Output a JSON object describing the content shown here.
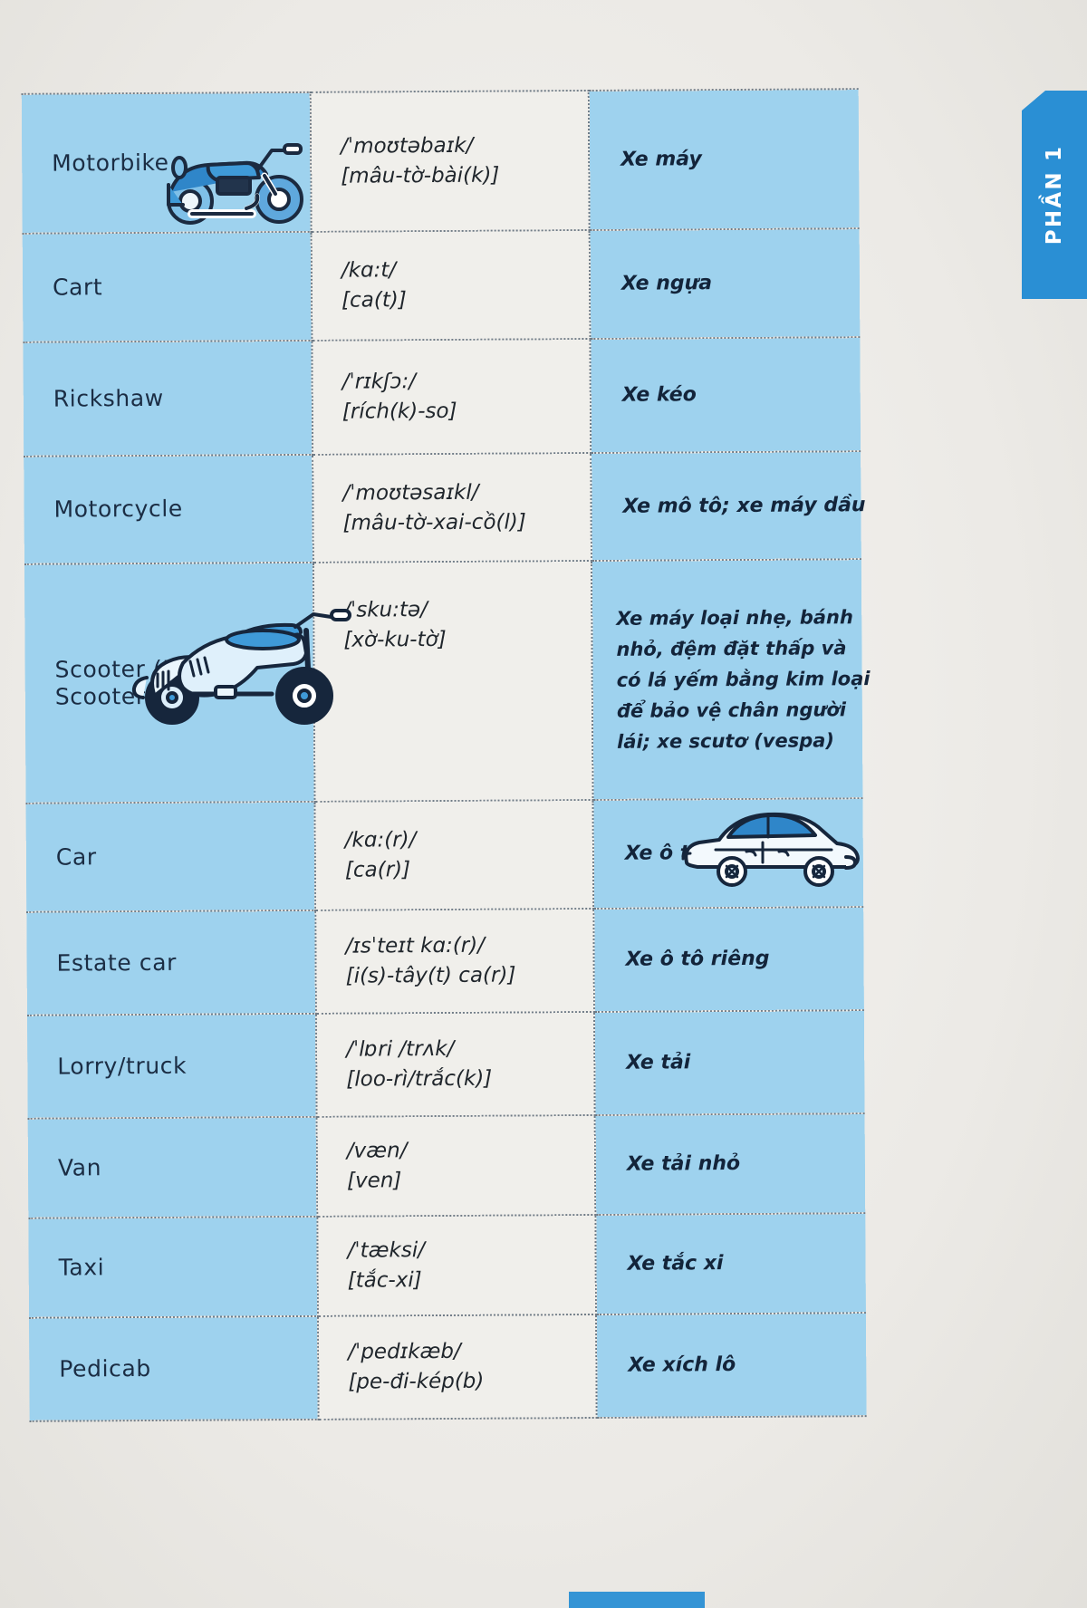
{
  "page": {
    "side_tab_label": "PHẦN 1",
    "accent_color": "#2a8fd4",
    "row_blue": "#9ed2ee",
    "row_cream": "#f0efeb"
  },
  "table": {
    "rows": [
      {
        "english": "Motorbike",
        "ipa": "/ˈmoʊtəbaɪk/",
        "viet_phonetic": "[mâu-tờ-bài(k)]",
        "meaning_lines": [
          "Xe máy"
        ],
        "illustration": "motorbike-illustration"
      },
      {
        "english": "Cart",
        "ipa": "/kɑ:t/",
        "viet_phonetic": "[ca(t)]",
        "meaning_lines": [
          "Xe ngựa"
        ],
        "illustration": null
      },
      {
        "english": "Rickshaw",
        "ipa": "/ˈrɪkʃɔ:/",
        "viet_phonetic": "[rích(k)-so]",
        "meaning_lines": [
          "Xe kéo"
        ],
        "illustration": null
      },
      {
        "english": "Motorcycle",
        "ipa": "/ˈmoʊtəsaɪkl/",
        "viet_phonetic": "[mâu-tờ-xai-cồ(l)]",
        "meaning_lines": [
          "Xe mô tô; xe máy dầu"
        ],
        "illustration": null
      },
      {
        "english": "Scooter (Motor Scooter)",
        "ipa": "/ˈsku:tə/",
        "viet_phonetic": "[xờ-ku-tờ]",
        "meaning_lines": [
          "Xe máy loại nhẹ, bánh",
          "nhỏ, đệm đặt thấp và",
          "có lá yếm bằng kim loại",
          "để bảo vệ chân người",
          "lái; xe scutơ (vespa)"
        ],
        "illustration": "scooter-illustration"
      },
      {
        "english": "Car",
        "ipa": "/kɑ:(r)/",
        "viet_phonetic": "[ca(r)]",
        "meaning_lines": [
          "Xe ô tô"
        ],
        "illustration": "car-illustration"
      },
      {
        "english": "Estate car",
        "ipa": "/ɪsˈteɪt kɑ:(r)/",
        "viet_phonetic": "[i(s)-tây(t) ca(r)]",
        "meaning_lines": [
          "Xe ô tô riêng"
        ],
        "illustration": null
      },
      {
        "english": "Lorry/truck",
        "ipa": "/ˈlɒri /trʌk/",
        "viet_phonetic": "[loo-rì/trắc(k)]",
        "meaning_lines": [
          "Xe tải"
        ],
        "illustration": null
      },
      {
        "english": "Van",
        "ipa": "/væn/",
        "viet_phonetic": "[ven]",
        "meaning_lines": [
          "Xe tải nhỏ"
        ],
        "illustration": null
      },
      {
        "english": "Taxi",
        "ipa": "/ˈtæksi/",
        "viet_phonetic": "[tắc-xi]",
        "meaning_lines": [
          "Xe tắc xi"
        ],
        "illustration": null
      },
      {
        "english": "Pedicab",
        "ipa": "/ˈpedɪkæb/",
        "viet_phonetic": "[pe-đi-kép(b)",
        "meaning_lines": [
          "Xe xích lô"
        ],
        "illustration": null
      }
    ]
  }
}
